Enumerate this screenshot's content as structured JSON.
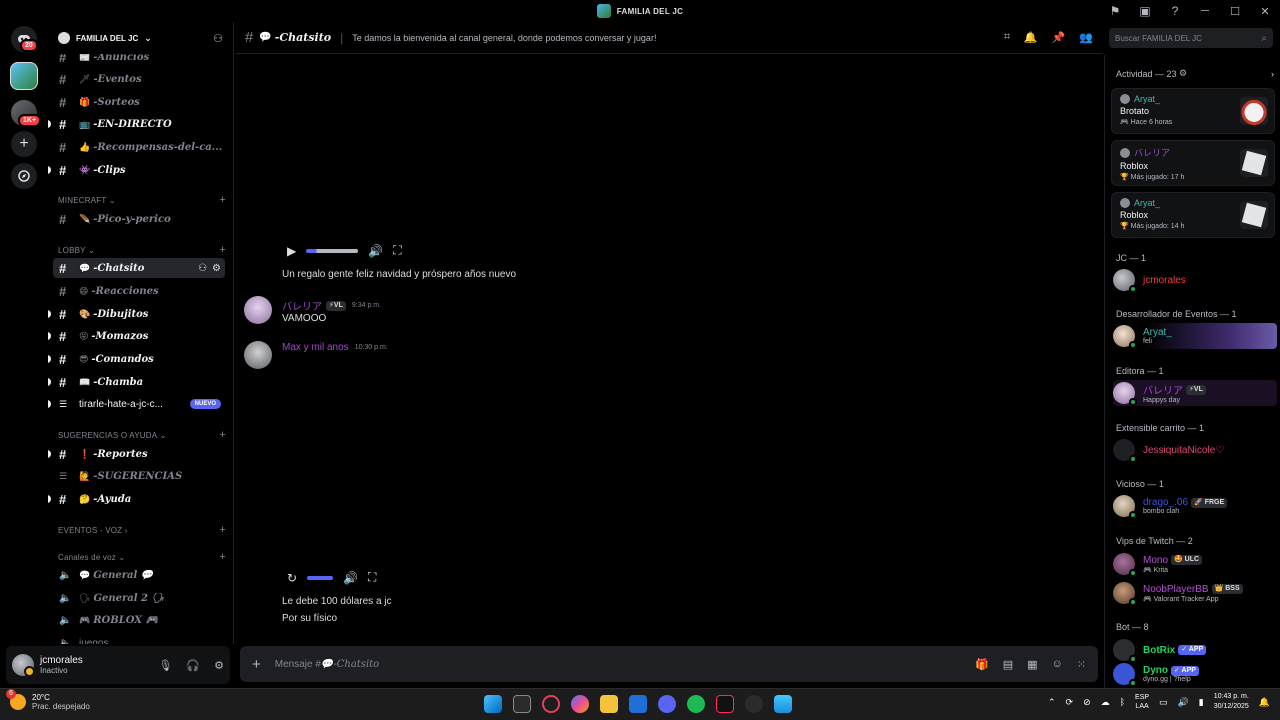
{
  "window": {
    "title": "FAMILIA DEL JC"
  },
  "rail": {
    "dm_badge": "20",
    "server_badge": "1K+"
  },
  "server": {
    "name": "FAMILIA DEL JC"
  },
  "channels": [
    {
      "emoji": "📰",
      "name": "-Anuncios"
    },
    {
      "emoji": "🗡",
      "name": "-Eventos"
    },
    {
      "emoji": "🎁",
      "name": "-Sorteos"
    },
    {
      "emoji": "📺",
      "name": "-EN-DIRECTO"
    },
    {
      "emoji": "👍",
      "name": "-Recompensas-del-ca..."
    },
    {
      "emoji": "👾",
      "name": "-Clips"
    },
    {
      "emoji": "🪶",
      "name": "-Pico-y-perico"
    },
    {
      "emoji": "💬",
      "name": "-Chatsito"
    },
    {
      "emoji": "😄",
      "name": "-Reacciones"
    },
    {
      "emoji": "🎨",
      "name": "-Dibujitos"
    },
    {
      "emoji": "😝",
      "name": "-Momazos"
    },
    {
      "emoji": "😎",
      "name": "-Comandos"
    },
    {
      "emoji": "📖",
      "name": "-Chamba"
    },
    {
      "emoji": "",
      "name": "tirarle-hate-a-jc-c..."
    },
    {
      "emoji": "❗",
      "name": "-Reportes"
    },
    {
      "emoji": "🙋",
      "name": "-SUGERENCIAS"
    },
    {
      "emoji": "🤔",
      "name": "-Ayuda"
    },
    {
      "emoji": "💬",
      "name": "General 💬"
    },
    {
      "emoji": "🗣",
      "name": "General 2 🗣"
    },
    {
      "emoji": "🎮",
      "name": "ROBLOX 🎮"
    },
    {
      "emoji": "",
      "name": "juegos"
    }
  ],
  "categories": {
    "minecraft": "MINECRAFT",
    "lobby": "LOBBY",
    "sugerencias": "SUGERENCIAS O AYUDA",
    "eventos_voz": "EVENTOS - VOZ",
    "canales_voz": "Canales de voz"
  },
  "new_badge": "NUEVO",
  "user": {
    "name": "jcmorales",
    "status": "Inactivo"
  },
  "chat": {
    "channel": "-Chatsito",
    "channel_emoji": "💬",
    "topic": "Te damos la bienvenida al canal general, donde podemos conversar y jugar!",
    "search_placeholder": "Buscar FAMILIA DEL JC",
    "messages": [
      {
        "text": "Un regalo gente feliz navidad y próspero años nuevo"
      },
      {
        "author": "バレリア",
        "tag": "⚡VL",
        "time": "9:34 p.m.",
        "text": "VAMOOO"
      },
      {
        "author": "Max y mil anos",
        "time": "10:30 p.m."
      },
      {
        "text": "Le debe 100 dólares a jc"
      },
      {
        "text": "Por su físico"
      }
    ],
    "composer_prefix": "Mensaje #",
    "composer_channel": "💬-Chatsito"
  },
  "members": {
    "activity_header": "Actividad — 23",
    "activities": [
      {
        "user": "Aryat_",
        "game": "Brotato",
        "detail": "🎮 Hace 6 horas"
      },
      {
        "user": "バレリア",
        "game": "Roblox",
        "detail": "🏆 Más jugado: 17 h"
      },
      {
        "user": "Aryat_",
        "game": "Roblox",
        "detail": "🏆 Más jugado: 14 h"
      }
    ],
    "groups": [
      {
        "label": "JC — 1"
      },
      {
        "label": "Desarrollador de Eventos — 1"
      },
      {
        "label": "Editora — 1"
      },
      {
        "label": "Extensible carrito — 1"
      },
      {
        "label": "Vicioso — 1"
      },
      {
        "label": "Vips de Twitch — 2"
      },
      {
        "label": "Bot — 8"
      }
    ],
    "list": [
      {
        "name": "jcmorales",
        "status": "",
        "tag": "",
        "color": "#f23f43"
      },
      {
        "name": "Aryat_",
        "status": "feli",
        "tag": "",
        "color": "#3fb8a8"
      },
      {
        "name": "バレリア",
        "status": "Happys day",
        "tag": "⚡VL",
        "color": "#a347d1"
      },
      {
        "name": "JessiquitaNicole♡",
        "status": "",
        "tag": "",
        "color": "#e0457b"
      },
      {
        "name": "drago_.06",
        "status": "bombo clah",
        "tag": "🚀 FRGE",
        "color": "#3c54d6"
      },
      {
        "name": "Mono",
        "status": "🎮 Krita",
        "tag": "🤩 ULC",
        "color": "#b64fd6"
      },
      {
        "name": "NoobPlayerBB",
        "status": "🎮 Valorant Tracker App",
        "tag": "👑 BSS",
        "color": "#b64fd6"
      },
      {
        "name": "BotRix",
        "status": "",
        "tag": "✓ APP",
        "color": "#23d160"
      },
      {
        "name": "Dyno",
        "status": "dyno.gg | ?help",
        "tag": "✓ APP",
        "color": "#23d160"
      }
    ]
  },
  "taskbar": {
    "weather_temp": "20°C",
    "weather_desc": "Prac. despejado",
    "weather_badge": "6",
    "lang_top": "ESP",
    "lang_bottom": "LAA",
    "time": "10:43 p. m.",
    "date": "30/12/2025"
  }
}
